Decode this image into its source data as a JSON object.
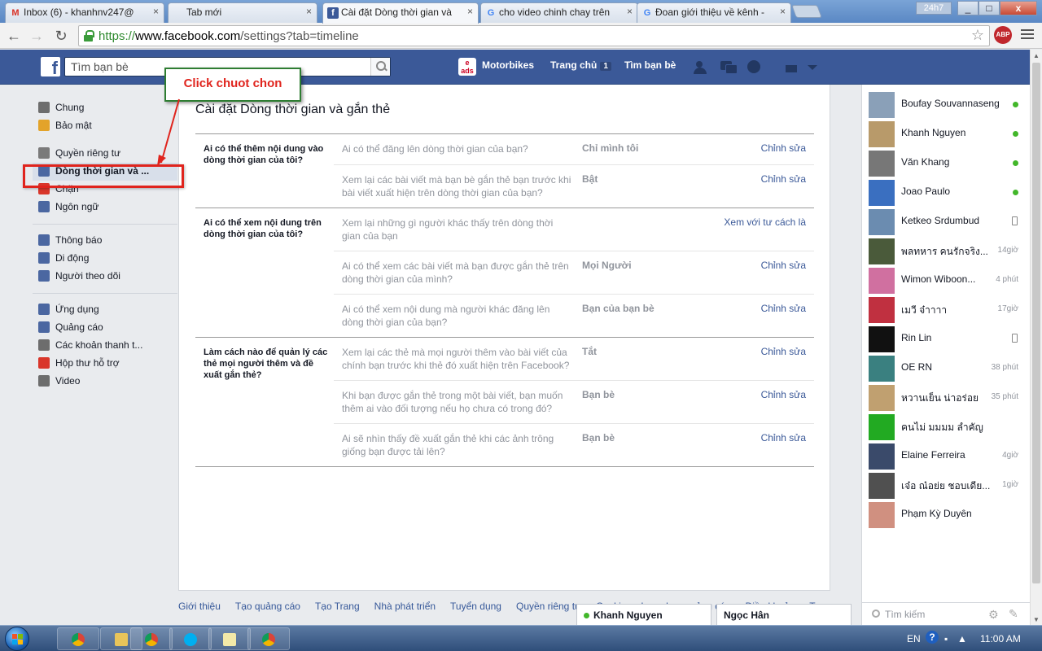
{
  "browser": {
    "tabs": [
      {
        "title": "Inbox (6) - khanhnv247@",
        "icon": "gmail-icon",
        "active": false
      },
      {
        "title": "Tab mới",
        "icon": "none",
        "active": false
      },
      {
        "title": "Cài đặt Dòng thời gian và",
        "icon": "facebook-icon",
        "active": true
      },
      {
        "title": "cho video chinh chay trên",
        "icon": "google-icon",
        "active": false
      },
      {
        "title": "Đoan giới thiệu về kênh -",
        "icon": "google-icon",
        "active": false
      }
    ],
    "profile_label": "24h7",
    "url_scheme": "https://",
    "url_host": "www.facebook.com",
    "url_path": "/settings?tab=timeline",
    "extension_label": "ABP"
  },
  "header": {
    "search_placeholder": "Tìm bạn bè",
    "page_name": "Motorbikes",
    "ads_logo_text": "e ads",
    "home_label": "Trang chủ",
    "home_count": "1",
    "find_friends_label": "Tìm bạn bè"
  },
  "leftnav": {
    "items": [
      {
        "label": "Chung",
        "icon": "gear-icon",
        "color": "#6d6d6d"
      },
      {
        "label": "Bảo mật",
        "icon": "shield-icon",
        "color": "#e3a32a"
      },
      {
        "label": "Quyền riêng tư",
        "icon": "lock-icon",
        "color": "#7a7a7a"
      },
      {
        "label": "Dòng thời gian và ...",
        "icon": "timeline-icon",
        "color": "#4b67a1",
        "selected": true
      },
      {
        "label": "Chặn",
        "icon": "block-icon",
        "color": "#d9362a"
      },
      {
        "label": "Ngôn ngữ",
        "icon": "globe-icon",
        "color": "#4b67a1"
      },
      {
        "label": "Thông báo",
        "icon": "globe-icon",
        "color": "#4b67a1"
      },
      {
        "label": "Di động",
        "icon": "mobile-icon",
        "color": "#4b67a1"
      },
      {
        "label": "Người theo dõi",
        "icon": "rss-icon",
        "color": "#4b67a1"
      },
      {
        "label": "Ứng dụng",
        "icon": "apps-icon",
        "color": "#4b67a1"
      },
      {
        "label": "Quảng cáo",
        "icon": "ads-icon",
        "color": "#4b67a1"
      },
      {
        "label": "Các khoản thanh t...",
        "icon": "card-icon",
        "color": "#6d6d6d"
      },
      {
        "label": "Hộp thư hỗ trợ",
        "icon": "lifebuoy-icon",
        "color": "#d9362a"
      },
      {
        "label": "Video",
        "icon": "film-icon",
        "color": "#6d6d6d"
      }
    ]
  },
  "main": {
    "title": "Cài đặt Dòng thời gian và gắn thẻ",
    "groups": [
      {
        "question": "Ai có thể thêm nội dung vào dòng thời gian của tôi?",
        "rows": [
          {
            "q": "Ai có thể đăng lên dòng thời gian của bạn?",
            "v": "Chỉ mình tôi",
            "edit": "Chỉnh sửa"
          },
          {
            "q": "Xem lại các bài viết mà bạn bè gắn thẻ bạn trước khi bài viết xuất hiện trên dòng thời gian của bạn?",
            "v": "Bật",
            "edit": "Chỉnh sửa"
          }
        ]
      },
      {
        "question": "Ai có thể xem nội dung trên dòng thời gian của tôi?",
        "rows": [
          {
            "q": "Xem lại những gì người khác thấy trên dòng thời gian của bạn",
            "v": "",
            "edit": "Xem với tư cách là"
          },
          {
            "q": "Ai có thể xem các bài viết mà bạn được gắn thẻ trên dòng thời gian của mình?",
            "v": "Mọi Người",
            "edit": "Chỉnh sửa"
          },
          {
            "q": "Ai có thể xem nội dung mà người khác đăng lên dòng thời gian của bạn?",
            "v": "Bạn của bạn bè",
            "edit": "Chỉnh sửa"
          }
        ]
      },
      {
        "question": "Làm cách nào để quản lý các thẻ mọi người thêm và đề xuất gắn thẻ?",
        "rows": [
          {
            "q": "Xem lại các thẻ mà mọi người thêm vào bài viết của chính bạn trước khi thẻ đó xuất hiện trên Facebook?",
            "v": "Tắt",
            "edit": "Chỉnh sửa"
          },
          {
            "q": "Khi bạn được gắn thẻ trong một bài viết, bạn muốn thêm ai vào đối tượng nếu họ chưa có trong đó?",
            "v": "Bạn bè",
            "edit": "Chỉnh sửa"
          },
          {
            "q": "Ai sẽ nhìn thấy đề xuất gắn thẻ khi các ảnh trông giống bạn được tải lên?",
            "v": "Bạn bè",
            "edit": "Chỉnh sửa"
          }
        ]
      }
    ]
  },
  "annotation": {
    "callout_text": "Click chuot chon",
    "color": "#e0241d"
  },
  "footer": {
    "links": [
      "Giới thiệu",
      "Tạo quảng cáo",
      "Tạo Trang",
      "Nhà phát triển",
      "Tuyển dụng",
      "Quyền riêng tư",
      "Cookie",
      "Lựa chọn quảng cáo",
      "Điều khoản",
      "Trợ"
    ]
  },
  "chat": {
    "contacts": [
      {
        "name": "Boufay Souvannaseng",
        "status": "online",
        "time": "",
        "avatar_color": "#8aa0b8"
      },
      {
        "name": "Khanh Nguyen",
        "status": "online",
        "time": "",
        "avatar_color": "#b89a6a"
      },
      {
        "name": "Văn Khang",
        "status": "online",
        "time": "",
        "avatar_color": "#777777"
      },
      {
        "name": "Joao Paulo",
        "status": "online",
        "time": "",
        "avatar_color": "#3a6fc0"
      },
      {
        "name": "Ketkeo Srdumbud",
        "status": "mobile",
        "time": "",
        "avatar_color": "#6b8cb0"
      },
      {
        "name": "พลทหาร คนรักจริง...",
        "status": "time",
        "time": "14giờ",
        "avatar_color": "#4a5a3a"
      },
      {
        "name": "Wimon Wiboon...",
        "status": "time",
        "time": "4 phút",
        "avatar_color": "#d070a0"
      },
      {
        "name": "เมวี จ๋าาาา",
        "status": "time",
        "time": "17giờ",
        "avatar_color": "#c03040"
      },
      {
        "name": "Rin Lin",
        "status": "mobile",
        "time": "",
        "avatar_color": "#111111"
      },
      {
        "name": "OE RN",
        "status": "time",
        "time": "38 phút",
        "avatar_color": "#3a8080"
      },
      {
        "name": "หวานเย็น น่าอร่อย",
        "status": "time",
        "time": "35 phút",
        "avatar_color": "#c0a070"
      },
      {
        "name": "คนไม่ มมมม ลำคัญ",
        "status": "none",
        "time": "",
        "avatar_color": "#22aa22"
      },
      {
        "name": "Elaine Ferreira",
        "status": "time",
        "time": "4giờ",
        "avatar_color": "#3a4a6a"
      },
      {
        "name": "เจ๋อ ณ๋อย่ย ชอบเดีย...",
        "status": "time",
        "time": "1giờ",
        "avatar_color": "#505050"
      },
      {
        "name": "Phạm Kỳ Duyên",
        "status": "none",
        "time": "",
        "avatar_color": "#d09080"
      }
    ],
    "search_label": "Tìm kiếm",
    "open_tabs": [
      "Khanh Nguyen",
      "Ngọc Hân"
    ]
  },
  "taskbar": {
    "lang": "EN",
    "time": "11:00 AM"
  }
}
